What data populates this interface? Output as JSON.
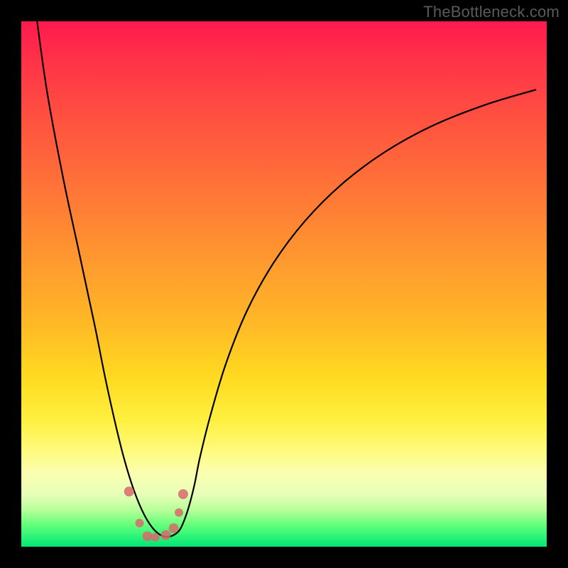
{
  "attribution": "TheBottleneck.com",
  "chart_data": {
    "type": "line",
    "title": "",
    "xlabel": "",
    "ylabel": "",
    "xlim": [
      0,
      100
    ],
    "ylim": [
      0,
      100
    ],
    "grid": false,
    "legend": false,
    "series": [
      {
        "name": "bottleneck-curve",
        "color": "#000000",
        "x": [
          3,
          5,
          8,
          11,
          14,
          16,
          18,
          19.5,
          21,
          22.5,
          24,
          25.5,
          27,
          28.5,
          30,
          31,
          32,
          33,
          34,
          36,
          39,
          43,
          48,
          54,
          61,
          69,
          78,
          88,
          98
        ],
        "y": [
          100,
          86,
          70,
          56,
          42,
          32,
          23,
          17,
          12,
          8,
          5,
          3,
          2,
          2,
          3,
          5,
          8,
          12,
          17,
          25,
          35,
          45,
          54,
          62,
          69,
          75,
          80,
          84,
          87
        ]
      },
      {
        "name": "highlight-markers",
        "type": "scatter",
        "color": "#d86a6a",
        "x": [
          20.5,
          22.5,
          24.0,
          25.5,
          27.5,
          29.0,
          30.0,
          30.8
        ],
        "y": [
          10.5,
          4.5,
          2.0,
          1.8,
          2.2,
          3.5,
          6.5,
          10.0
        ],
        "r": [
          7,
          6,
          7,
          6,
          7,
          7,
          6,
          7
        ]
      }
    ],
    "background_gradient": {
      "direction": "vertical",
      "stops": [
        {
          "pos": 0.0,
          "color": "#ff1a4d"
        },
        {
          "pos": 0.5,
          "color": "#ffba26"
        },
        {
          "pos": 0.8,
          "color": "#fff55a"
        },
        {
          "pos": 1.0,
          "color": "#00e876"
        }
      ]
    }
  }
}
